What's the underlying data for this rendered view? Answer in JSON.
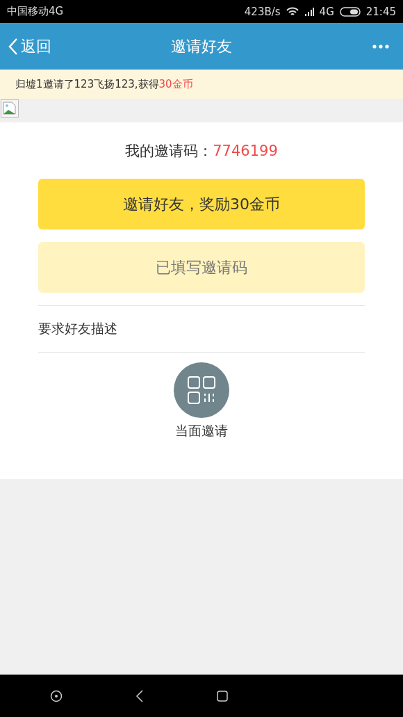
{
  "status_bar": {
    "carrier": "中国移动4G",
    "speed": "423B/s",
    "network": "4G",
    "time": "21:45"
  },
  "header": {
    "back": "返回",
    "title": "邀请好友"
  },
  "notice": {
    "text": "归墟1邀请了123飞扬123,获得",
    "reward": "30金币"
  },
  "invite_code": {
    "label": "我的邀请码：",
    "code": "7746199"
  },
  "buttons": [
    {
      "label": "邀请好友，奖励30金币",
      "kind": "primary"
    },
    {
      "label": "已填写邀请码",
      "kind": "muted"
    }
  ],
  "requirement": "要求好友描述",
  "face_invite": {
    "label": "当面邀请"
  }
}
